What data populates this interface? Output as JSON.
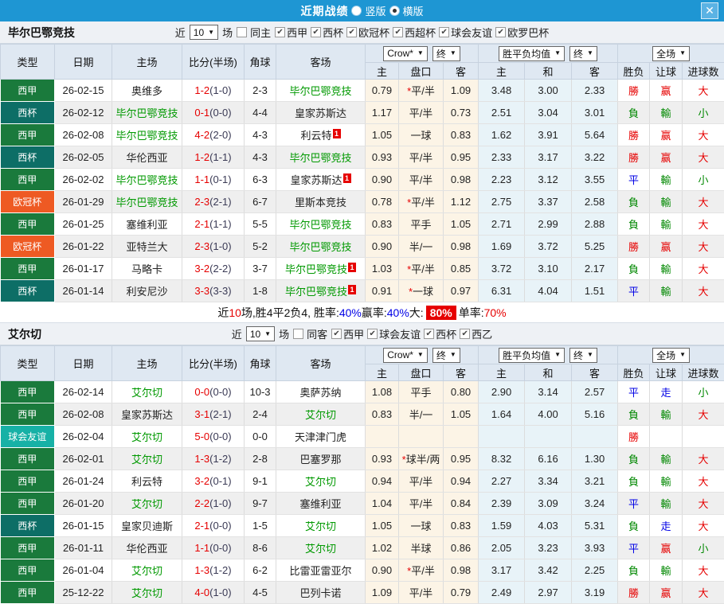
{
  "topbar": {
    "title": "近期战绩",
    "radio_vertical": "竖版",
    "radio_horizontal": "横版",
    "selected": "横版",
    "close": "✕"
  },
  "colors": {
    "topbar_bg": "#1e96d3",
    "highlight_team": "#009900",
    "type_colors": {
      "西甲": "#1a7a3c",
      "西杯": "#0d6e66",
      "欧冠杯": "#ee5a23",
      "球会友谊": "#17b1a6",
      "西乙": "#1a7a3c"
    },
    "result_colors": {
      "勝": "#e60000",
      "負": "#008800",
      "平": "#0000e6",
      "赢": "#e60000",
      "輸": "#008800",
      "走": "#0000e6",
      "大": "#e60000",
      "小": "#008800"
    }
  },
  "headers": {
    "type": "类型",
    "date": "日期",
    "home": "主场",
    "score": "比分(半场)",
    "corner": "角球",
    "away": "客场",
    "selects": {
      "crown": "Crow*",
      "final": "终",
      "avg": "胜平负均值",
      "final2": "终",
      "scope": "全场"
    },
    "sub": [
      "主",
      "盘口",
      "客",
      "主",
      "和",
      "客",
      "胜负",
      "让球",
      "进球数"
    ]
  },
  "row_fields": [
    "type",
    "date",
    "home",
    "home_highlight",
    "home_badge",
    "ft_score",
    "ht_score",
    "corner",
    "away",
    "away_highlight",
    "away_badge",
    "crown_home",
    "handicap_star",
    "handicap",
    "crown_away",
    "avg_win",
    "avg_draw",
    "avg_lose",
    "result",
    "handicap_result",
    "goals_result"
  ],
  "sections": [
    {
      "team": "毕尔巴鄂竞技",
      "filter": {
        "near": "近",
        "count": "10",
        "unit": "场",
        "same_label": "同主",
        "same_checked": false,
        "leagues": [
          {
            "label": "西甲",
            "checked": true
          },
          {
            "label": "西杯",
            "checked": true
          },
          {
            "label": "欧冠杯",
            "checked": true
          },
          {
            "label": "西超杯",
            "checked": true
          },
          {
            "label": "球会友谊",
            "checked": true
          },
          {
            "label": "欧罗巴杯",
            "checked": true
          }
        ]
      },
      "rows": [
        [
          "西甲",
          "26-02-15",
          "奥维多",
          0,
          "",
          "1-2",
          "(1-0)",
          "2-3",
          "毕尔巴鄂竞技",
          1,
          "",
          "0.79",
          1,
          "平/半",
          "1.09",
          "3.48",
          "3.00",
          "2.33",
          "勝",
          "赢",
          "大"
        ],
        [
          "西杯",
          "26-02-12",
          "毕尔巴鄂竞技",
          1,
          "",
          "0-1",
          "(0-0)",
          "4-4",
          "皇家苏斯达",
          0,
          "",
          "1.17",
          0,
          "平/半",
          "0.73",
          "2.51",
          "3.04",
          "3.01",
          "負",
          "輸",
          "小"
        ],
        [
          "西甲",
          "26-02-08",
          "毕尔巴鄂竞技",
          1,
          "",
          "4-2",
          "(2-0)",
          "4-3",
          "利云特",
          0,
          "1",
          "1.05",
          0,
          "一球",
          "0.83",
          "1.62",
          "3.91",
          "5.64",
          "勝",
          "赢",
          "大"
        ],
        [
          "西杯",
          "26-02-05",
          "华伦西亚",
          0,
          "",
          "1-2",
          "(1-1)",
          "4-3",
          "毕尔巴鄂竞技",
          1,
          "",
          "0.93",
          0,
          "平/半",
          "0.95",
          "2.33",
          "3.17",
          "3.22",
          "勝",
          "赢",
          "大"
        ],
        [
          "西甲",
          "26-02-02",
          "毕尔巴鄂竞技",
          1,
          "",
          "1-1",
          "(0-1)",
          "6-3",
          "皇家苏斯达",
          0,
          "1",
          "0.90",
          0,
          "平/半",
          "0.98",
          "2.23",
          "3.12",
          "3.55",
          "平",
          "輸",
          "小"
        ],
        [
          "欧冠杯",
          "26-01-29",
          "毕尔巴鄂竞技",
          1,
          "",
          "2-3",
          "(2-1)",
          "6-7",
          "里斯本竞技",
          0,
          "",
          "0.78",
          1,
          "平/半",
          "1.12",
          "2.75",
          "3.37",
          "2.58",
          "負",
          "輸",
          "大"
        ],
        [
          "西甲",
          "26-01-25",
          "塞维利亚",
          0,
          "",
          "2-1",
          "(1-1)",
          "5-5",
          "毕尔巴鄂竞技",
          1,
          "",
          "0.83",
          0,
          "平手",
          "1.05",
          "2.71",
          "2.99",
          "2.88",
          "負",
          "輸",
          "大"
        ],
        [
          "欧冠杯",
          "26-01-22",
          "亚特兰大",
          0,
          "",
          "2-3",
          "(1-0)",
          "5-2",
          "毕尔巴鄂竞技",
          1,
          "",
          "0.90",
          0,
          "半/一",
          "0.98",
          "1.69",
          "3.72",
          "5.25",
          "勝",
          "赢",
          "大"
        ],
        [
          "西甲",
          "26-01-17",
          "马略卡",
          0,
          "",
          "3-2",
          "(2-2)",
          "3-7",
          "毕尔巴鄂竞技",
          1,
          "1",
          "1.03",
          1,
          "平/半",
          "0.85",
          "3.72",
          "3.10",
          "2.17",
          "負",
          "輸",
          "大"
        ],
        [
          "西杯",
          "26-01-14",
          "利安尼沙",
          0,
          "",
          "3-3",
          "(3-3)",
          "1-8",
          "毕尔巴鄂竞技",
          1,
          "1",
          "0.91",
          1,
          "一球",
          "0.97",
          "6.31",
          "4.04",
          "1.51",
          "平",
          "輸",
          "大"
        ]
      ],
      "summary": [
        {
          "text": "近",
          "style": "plain"
        },
        {
          "text": "10",
          "style": "red"
        },
        {
          "text": "场,胜4平2负4, 胜率:",
          "style": "plain"
        },
        {
          "text": "40%",
          "style": "blue"
        },
        {
          "text": " 赢率:",
          "style": "plain"
        },
        {
          "text": "40%",
          "style": "blue"
        },
        {
          "text": " 大:",
          "style": "plain"
        },
        {
          "text": "80%",
          "style": "badge"
        },
        {
          "text": " 单率:",
          "style": "plain"
        },
        {
          "text": "70%",
          "style": "red"
        }
      ]
    },
    {
      "team": "艾尔切",
      "filter": {
        "near": "近",
        "count": "10",
        "unit": "场",
        "same_label": "同客",
        "same_checked": false,
        "leagues": [
          {
            "label": "西甲",
            "checked": true
          },
          {
            "label": "球会友谊",
            "checked": true
          },
          {
            "label": "西杯",
            "checked": true
          },
          {
            "label": "西乙",
            "checked": true
          }
        ]
      },
      "rows": [
        [
          "西甲",
          "26-02-14",
          "艾尔切",
          1,
          "",
          "0-0",
          "(0-0)",
          "10-3",
          "奥萨苏纳",
          0,
          "",
          "1.08",
          0,
          "平手",
          "0.80",
          "2.90",
          "3.14",
          "2.57",
          "平",
          "走",
          "小"
        ],
        [
          "西甲",
          "26-02-08",
          "皇家苏斯达",
          0,
          "",
          "3-1",
          "(2-1)",
          "2-4",
          "艾尔切",
          1,
          "",
          "0.83",
          0,
          "半/一",
          "1.05",
          "1.64",
          "4.00",
          "5.16",
          "負",
          "輸",
          "大"
        ],
        [
          "球会友谊",
          "26-02-04",
          "艾尔切",
          1,
          "",
          "5-0",
          "(0-0)",
          "0-0",
          "天津津门虎",
          0,
          "",
          "",
          0,
          "",
          "",
          "",
          "",
          "",
          "勝",
          "",
          ""
        ],
        [
          "西甲",
          "26-02-01",
          "艾尔切",
          1,
          "",
          "1-3",
          "(1-2)",
          "2-8",
          "巴塞罗那",
          0,
          "",
          "0.93",
          1,
          "球半/两",
          "0.95",
          "8.32",
          "6.16",
          "1.30",
          "負",
          "輸",
          "大"
        ],
        [
          "西甲",
          "26-01-24",
          "利云特",
          0,
          "",
          "3-2",
          "(0-1)",
          "9-1",
          "艾尔切",
          1,
          "",
          "0.94",
          0,
          "平/半",
          "0.94",
          "2.27",
          "3.34",
          "3.21",
          "負",
          "輸",
          "大"
        ],
        [
          "西甲",
          "26-01-20",
          "艾尔切",
          1,
          "",
          "2-2",
          "(1-0)",
          "9-7",
          "塞维利亚",
          0,
          "",
          "1.04",
          0,
          "平/半",
          "0.84",
          "2.39",
          "3.09",
          "3.24",
          "平",
          "輸",
          "大"
        ],
        [
          "西杯",
          "26-01-15",
          "皇家贝迪斯",
          0,
          "",
          "2-1",
          "(0-0)",
          "1-5",
          "艾尔切",
          1,
          "",
          "1.05",
          0,
          "一球",
          "0.83",
          "1.59",
          "4.03",
          "5.31",
          "負",
          "走",
          "大"
        ],
        [
          "西甲",
          "26-01-11",
          "华伦西亚",
          0,
          "",
          "1-1",
          "(0-0)",
          "8-6",
          "艾尔切",
          1,
          "",
          "1.02",
          0,
          "半球",
          "0.86",
          "2.05",
          "3.23",
          "3.93",
          "平",
          "赢",
          "小"
        ],
        [
          "西甲",
          "26-01-04",
          "艾尔切",
          1,
          "",
          "1-3",
          "(1-2)",
          "6-2",
          "比雷亚雷亚尔",
          0,
          "",
          "0.90",
          1,
          "平/半",
          "0.98",
          "3.17",
          "3.42",
          "2.25",
          "負",
          "輸",
          "大"
        ],
        [
          "西甲",
          "25-12-22",
          "艾尔切",
          1,
          "",
          "4-0",
          "(1-0)",
          "4-5",
          "巴列卡诺",
          0,
          "",
          "1.09",
          0,
          "平/半",
          "0.79",
          "2.49",
          "2.97",
          "3.19",
          "勝",
          "赢",
          "大"
        ]
      ]
    }
  ]
}
